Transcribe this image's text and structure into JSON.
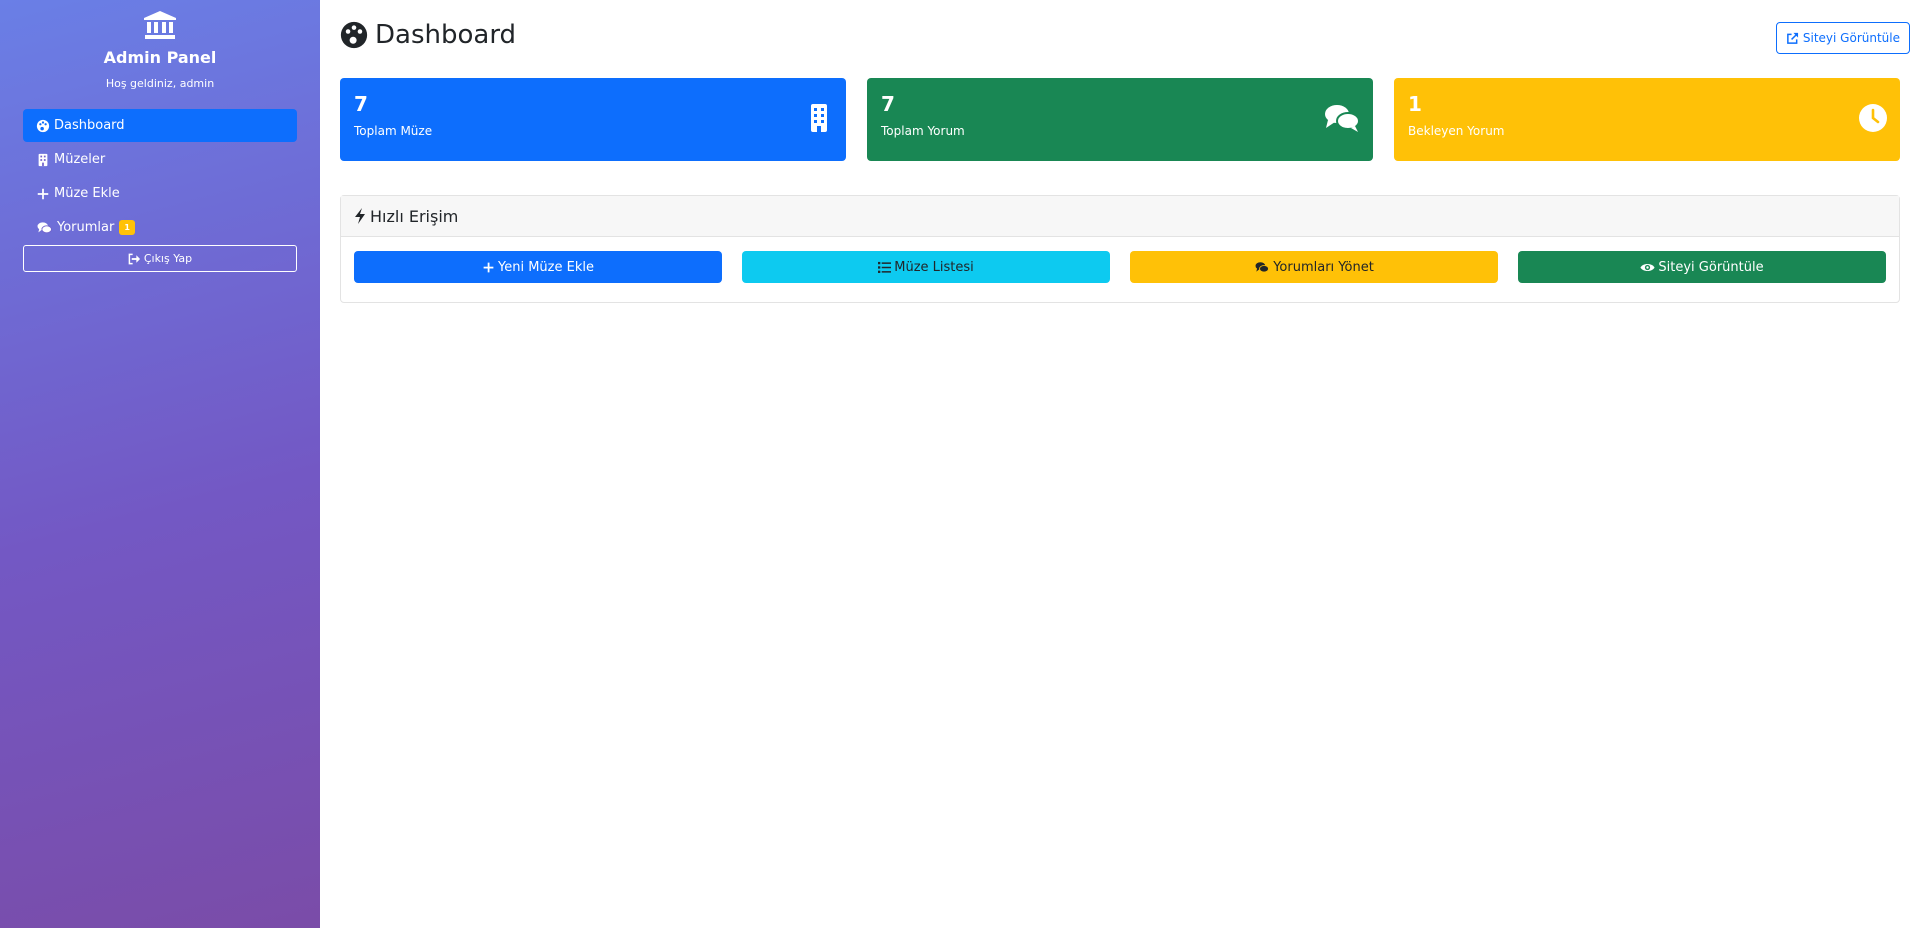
{
  "sidebar": {
    "title": "Admin Panel",
    "welcome": "Hoş geldiniz, admin",
    "items": [
      {
        "label": "Dashboard",
        "icon": "palette-icon"
      },
      {
        "label": "Müzeler",
        "icon": "building-icon"
      },
      {
        "label": "Müze Ekle",
        "icon": "plus-icon"
      },
      {
        "label": "Yorumlar",
        "icon": "comments-icon",
        "badge": "1"
      }
    ],
    "logout_label": "Çıkış Yap"
  },
  "header": {
    "title": "Dashboard",
    "view_site_label": "Siteyi Görüntüle"
  },
  "stats": [
    {
      "value": "7",
      "label": "Toplam Müze",
      "color": "#0d6efd",
      "icon": "building-icon"
    },
    {
      "value": "7",
      "label": "Toplam Yorum",
      "color": "#198754",
      "icon": "comments-icon"
    },
    {
      "value": "1",
      "label": "Bekleyen Yorum",
      "color": "#ffc107",
      "icon": "clock-icon"
    }
  ],
  "quick_access": {
    "title": "Hızlı Erişim",
    "buttons": [
      {
        "label": "Yeni Müze Ekle",
        "color": "#0d6efd",
        "icon": "plus-icon"
      },
      {
        "label": "Müze Listesi",
        "color": "#0dcaf0",
        "icon": "list-icon"
      },
      {
        "label": "Yorumları Yönet",
        "color": "#ffc107",
        "icon": "comments-icon"
      },
      {
        "label": "Siteyi Görüntüle",
        "color": "#198754",
        "icon": "eye-icon"
      }
    ]
  }
}
